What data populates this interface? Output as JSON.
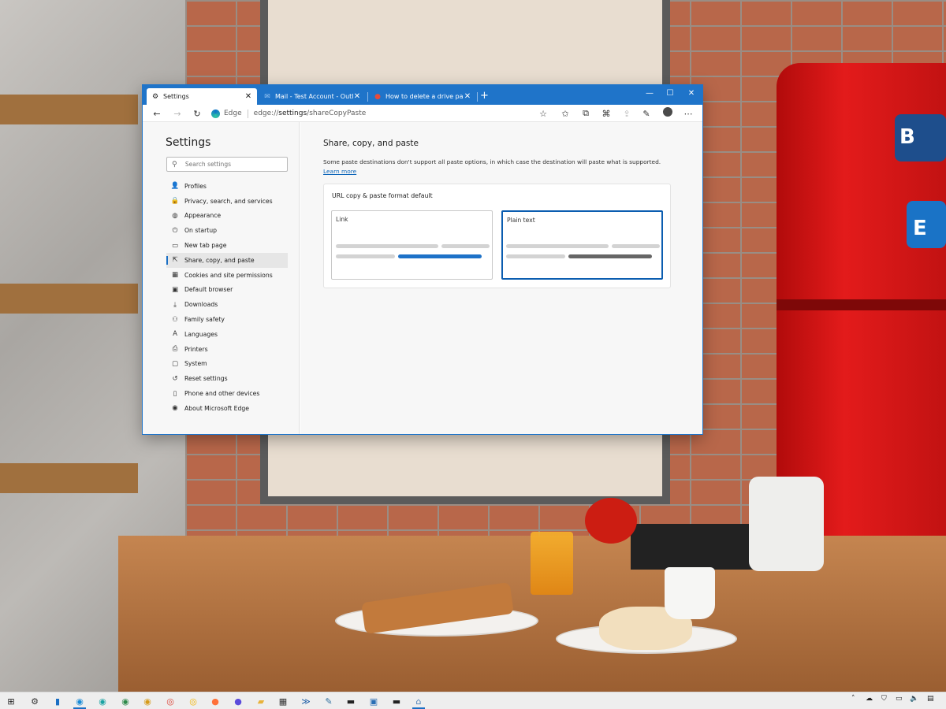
{
  "browser": {
    "tabs": [
      {
        "label": "Settings",
        "icon": "gear-icon",
        "active": true
      },
      {
        "label": "Mail - Test Account - Outlook",
        "icon": "outlook-icon",
        "active": false
      },
      {
        "label": "How to delete a drive partition o",
        "icon": "windows-central-icon",
        "active": false
      }
    ],
    "new_tab_glyph": "+",
    "window_controls": {
      "minimize": "—",
      "maximize": "☐",
      "close": "✕"
    },
    "address": {
      "scheme_label": "Edge",
      "url_prefix": "edge://",
      "url_host": "settings",
      "url_path": "/shareCopyPaste"
    },
    "accent_color": "#1f74c9"
  },
  "sidebar": {
    "title": "Settings",
    "search_placeholder": "Search settings",
    "items": [
      {
        "label": "Profiles",
        "icon": "profile-icon"
      },
      {
        "label": "Privacy, search, and services",
        "icon": "lock-icon"
      },
      {
        "label": "Appearance",
        "icon": "palette-icon"
      },
      {
        "label": "On startup",
        "icon": "power-icon"
      },
      {
        "label": "New tab page",
        "icon": "new-tab-icon"
      },
      {
        "label": "Share, copy, and paste",
        "icon": "share-icon",
        "selected": true
      },
      {
        "label": "Cookies and site permissions",
        "icon": "cookie-icon"
      },
      {
        "label": "Default browser",
        "icon": "browser-icon"
      },
      {
        "label": "Downloads",
        "icon": "download-icon"
      },
      {
        "label": "Family safety",
        "icon": "family-icon"
      },
      {
        "label": "Languages",
        "icon": "language-icon"
      },
      {
        "label": "Printers",
        "icon": "printer-icon"
      },
      {
        "label": "System",
        "icon": "system-icon"
      },
      {
        "label": "Reset settings",
        "icon": "reset-icon"
      },
      {
        "label": "Phone and other devices",
        "icon": "phone-icon"
      },
      {
        "label": "About Microsoft Edge",
        "icon": "edge-icon"
      }
    ]
  },
  "main": {
    "title": "Share, copy, and paste",
    "description": "Some paste destinations don't support all paste options, in which case the destination will paste what is supported.",
    "learn_more": "Learn more",
    "card": {
      "title": "URL copy & paste format default",
      "options": [
        {
          "label": "Link",
          "selected": false
        },
        {
          "label": "Plain text",
          "selected": true
        }
      ]
    }
  },
  "taskbar": {
    "apps": [
      "start-icon",
      "settings-icon",
      "file-icon",
      "edge-icon",
      "edge-beta-icon",
      "edge-dev-icon",
      "edge-canary-icon",
      "chrome-icon",
      "chrome-canary-icon",
      "firefox-icon",
      "firefox-dev-icon",
      "folder-icon",
      "store-icon",
      "powershell-icon",
      "notepad-icon",
      "photos-icon",
      "terminal-icon",
      "cmd-icon",
      "network-drive-icon"
    ]
  }
}
